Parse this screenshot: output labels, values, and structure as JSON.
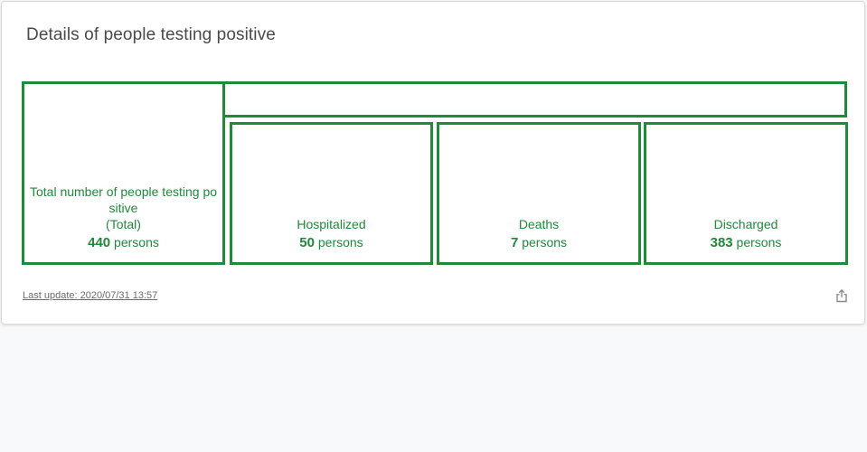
{
  "card": {
    "title": "Details of people testing positive"
  },
  "boxes": {
    "total": {
      "label_line1": "Total number of people testing po",
      "label_line2": "sitive",
      "label_line3": "(Total)",
      "value": "440",
      "unit": "persons"
    },
    "hospitalized": {
      "label": "Hospitalized",
      "value": "50",
      "unit": "persons"
    },
    "deaths": {
      "label": "Deaths",
      "value": "7",
      "unit": "persons"
    },
    "discharged": {
      "label": "Discharged",
      "value": "383",
      "unit": "persons"
    }
  },
  "footer": {
    "last_update": "Last update: 2020/07/31 13:57",
    "share_icon": "share-icon"
  },
  "colors": {
    "accent": "#1e8a3a",
    "title": "#4a4a4a",
    "background": "#f8f9fb"
  }
}
